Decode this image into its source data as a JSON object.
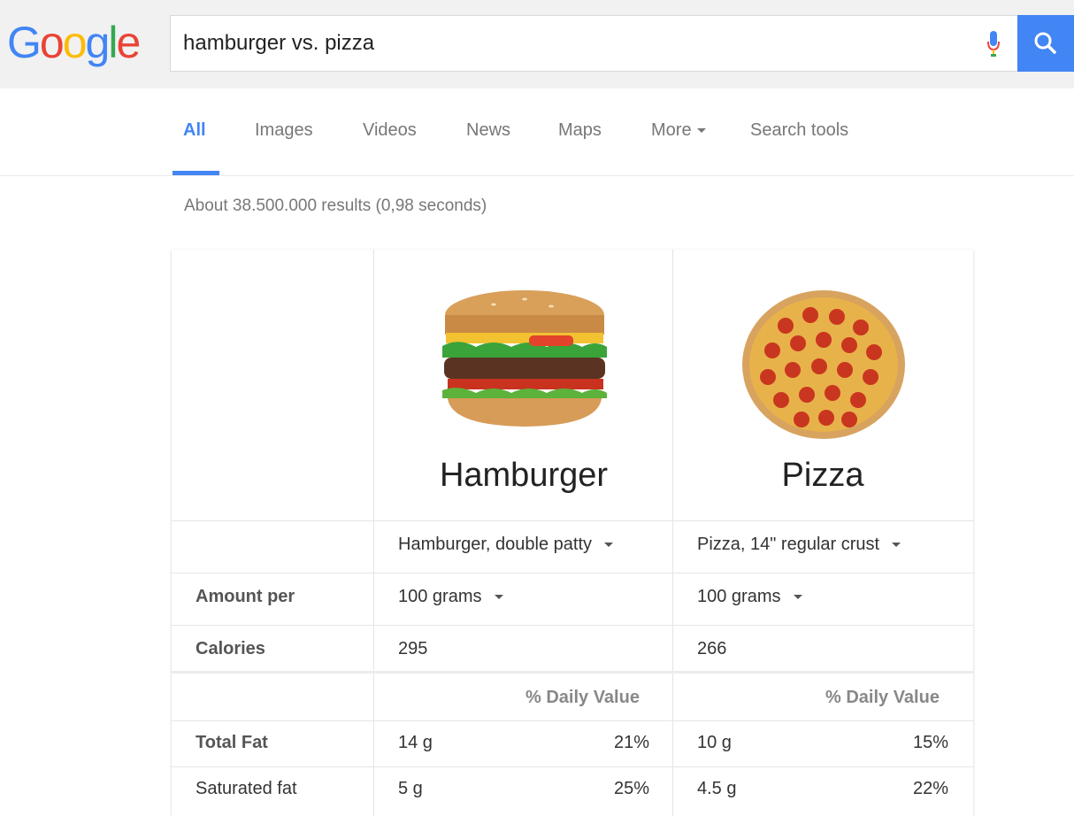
{
  "logo": {
    "letters": [
      "G",
      "o",
      "o",
      "g",
      "l",
      "e"
    ],
    "colors": [
      "#4285f4",
      "#ea4335",
      "#fbbc05",
      "#4285f4",
      "#34a853",
      "#ea4335"
    ]
  },
  "search": {
    "query": "hamburger vs. pizza"
  },
  "tabs": [
    {
      "label": "All",
      "active": true
    },
    {
      "label": "Images"
    },
    {
      "label": "Videos"
    },
    {
      "label": "News"
    },
    {
      "label": "Maps"
    },
    {
      "label": "More"
    },
    {
      "label": "Search tools"
    }
  ],
  "results_count": "About 38.500.000 results (0,98 seconds)",
  "comparison": {
    "foods": [
      {
        "name": "Hamburger",
        "variant": "Hamburger, double patty",
        "amount": "100 grams",
        "calories": "295",
        "total_fat": "14 g",
        "total_fat_pct": "21%",
        "sat_fat": "5 g",
        "sat_fat_pct": "25%"
      },
      {
        "name": "Pizza",
        "variant": "Pizza, 14\" regular crust",
        "amount": "100 grams",
        "calories": "266",
        "total_fat": "10 g",
        "total_fat_pct": "15%",
        "sat_fat": "4.5 g",
        "sat_fat_pct": "22%"
      }
    ],
    "labels": {
      "amount_per": "Amount per",
      "calories": "Calories",
      "total_fat": "Total Fat",
      "sat_fat": "Saturated fat",
      "daily_value": "% Daily Value"
    }
  }
}
